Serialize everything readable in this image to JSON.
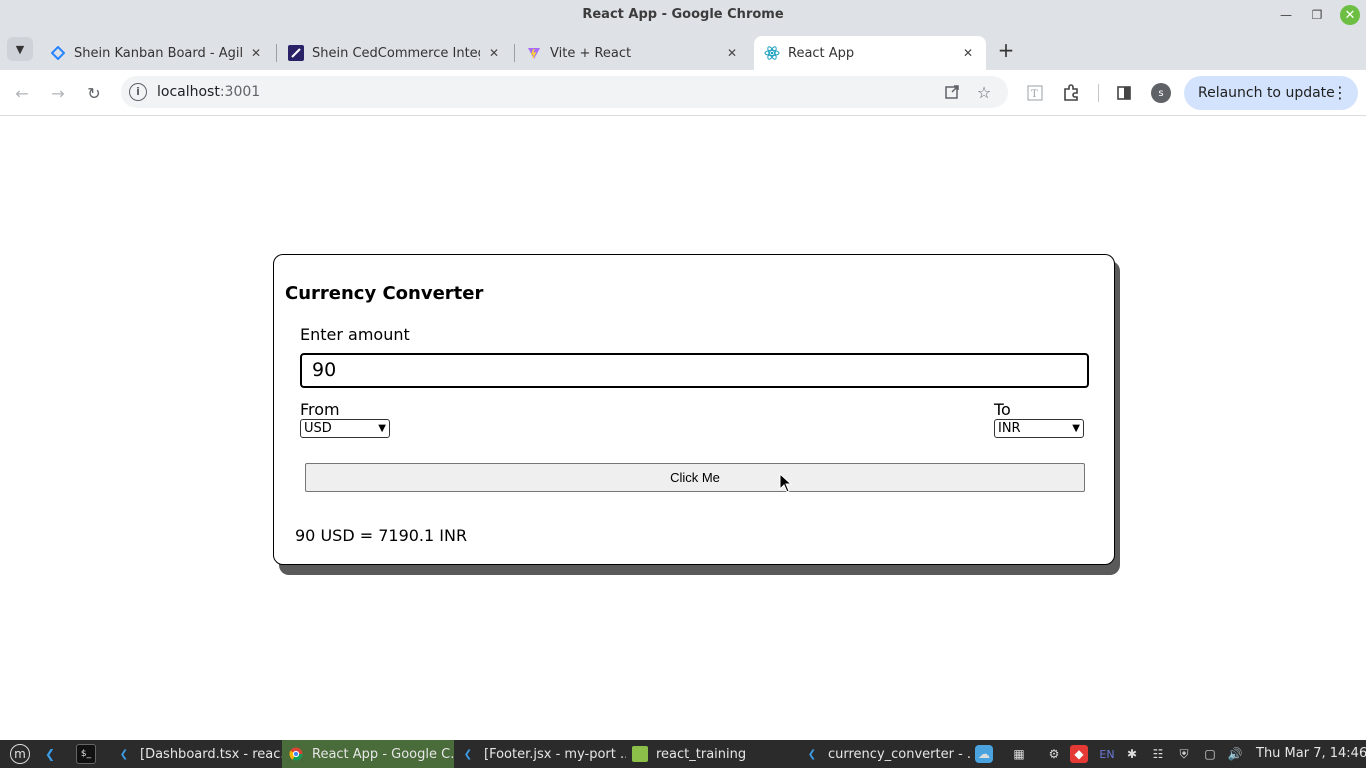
{
  "window": {
    "title": "React App - Google Chrome"
  },
  "tabs": [
    {
      "label": "Shein Kanban Board - Agile b",
      "icon": "jira-icon",
      "active": false
    },
    {
      "label": "Shein CedCommerce Integra",
      "icon": "cedcommerce-icon",
      "active": false
    },
    {
      "label": "Vite + React",
      "icon": "vite-icon",
      "active": false
    },
    {
      "label": "React App",
      "icon": "react-icon",
      "active": true
    }
  ],
  "toolbar": {
    "url_host": "localhost",
    "url_port": ":3001",
    "relaunch_label": "Relaunch to update",
    "profile_initial": "s"
  },
  "page": {
    "title": "Currency Converter",
    "amount_label": "Enter amount",
    "amount_value": "90",
    "from_label": "From",
    "from_value": "USD",
    "to_label": "To",
    "to_value": "INR",
    "button_label": "Click Me",
    "result_text": "90 USD = 7190.1 INR"
  },
  "taskbar": {
    "apps": [
      {
        "label": "[Dashboard.tsx - reac...",
        "icon": "vscode-icon",
        "active": false
      },
      {
        "label": "React App - Google C...",
        "icon": "chrome-icon",
        "active": true
      },
      {
        "label": "[Footer.jsx - my-port ...",
        "icon": "vscode-icon",
        "active": false
      },
      {
        "label": "react_training",
        "icon": "folder-icon",
        "active": false
      },
      {
        "label": "currency_converter - ...",
        "icon": "vscode-icon",
        "active": false
      }
    ],
    "language": "EN",
    "clock": "Thu Mar  7, 14:46"
  },
  "colors": {
    "accent_green": "#6cbf42",
    "relaunch_bg": "#d3e3fd",
    "taskbar_bg": "#2b2b2b",
    "active_task": "#4a6b3a"
  }
}
